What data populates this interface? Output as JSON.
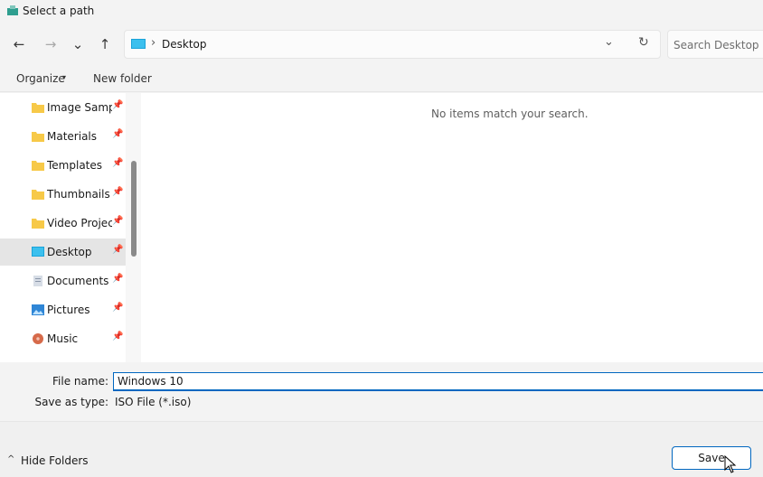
{
  "window": {
    "title": "Select a path"
  },
  "nav": {
    "back": "←",
    "forward": "→",
    "recent": "⌄",
    "up": "↑"
  },
  "address": {
    "path": "Desktop",
    "separator": "›",
    "dropdown": "⌄",
    "refresh": "↻"
  },
  "search": {
    "placeholder": "Search Desktop"
  },
  "commands": {
    "organize": "Organize",
    "organize_caret": "▾",
    "new_folder": "New folder"
  },
  "sidebar": {
    "items": [
      {
        "label": "Image Sampl",
        "icon": "folder-icon",
        "pinned": true
      },
      {
        "label": "Materials",
        "icon": "folder-icon",
        "pinned": true
      },
      {
        "label": "Templates",
        "icon": "folder-icon",
        "pinned": true
      },
      {
        "label": "Thumbnails",
        "icon": "folder-icon",
        "pinned": true
      },
      {
        "label": "Video Project",
        "icon": "folder-icon",
        "pinned": true
      },
      {
        "label": "Desktop",
        "icon": "desktop-icon",
        "pinned": true,
        "selected": true
      },
      {
        "label": "Documents",
        "icon": "documents-icon",
        "pinned": true
      },
      {
        "label": "Pictures",
        "icon": "pictures-icon",
        "pinned": true
      },
      {
        "label": "Music",
        "icon": "music-icon",
        "pinned": true
      }
    ],
    "pin_glyph": "📌"
  },
  "content": {
    "empty_message": "No items match your search."
  },
  "form": {
    "file_name_label": "File name:",
    "file_name_value": "Windows 10",
    "save_as_type_label": "Save as type:",
    "save_as_type_value": "ISO File (*.iso)"
  },
  "footer": {
    "hide_folders": "Hide Folders",
    "hide_caret": "^",
    "save": "Save"
  },
  "colors": {
    "accent": "#0067c0",
    "folder": "#f7c948",
    "selected": "#e5e5e5"
  }
}
